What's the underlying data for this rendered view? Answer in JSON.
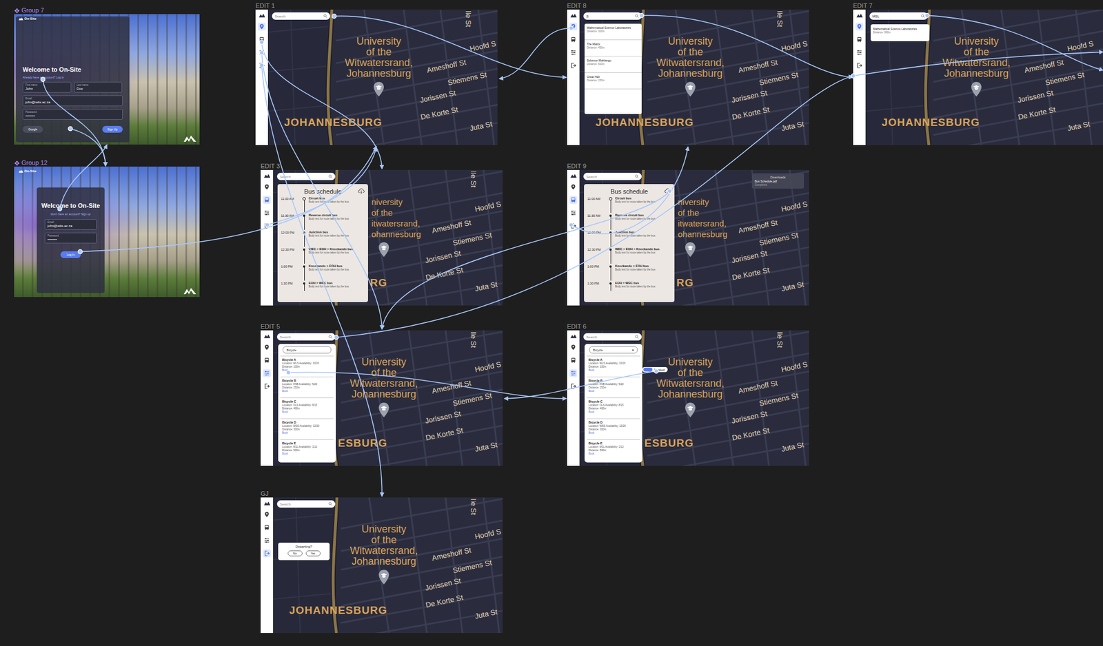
{
  "canvas": {
    "login_frames": [
      {
        "label": "Group 7",
        "kind": "signup",
        "brand": "On-Site",
        "title": "Welcome to On-Site",
        "subtitle": "Already have an account? Log in",
        "fields": [
          {
            "label": "First name",
            "value": "John",
            "kind": "half"
          },
          {
            "label": "Last name",
            "value": "Doe",
            "kind": "half"
          },
          {
            "label": "Email",
            "value": "john@wits.ac.za",
            "kind": "full"
          },
          {
            "label": "Password",
            "value": "••••••••",
            "kind": "full"
          }
        ],
        "buttons": [
          {
            "label": "Google",
            "kind": "secondary"
          },
          {
            "label": "Sign Up",
            "kind": "primary"
          }
        ]
      },
      {
        "label": "Group 12",
        "kind": "login",
        "brand": "On-Site",
        "title": "Welcome to On-Site",
        "subtitle": "Don't have an account? Sign up",
        "fields": [
          {
            "label": "Email",
            "value": "john@wits.ac.za",
            "kind": "full"
          },
          {
            "label": "Password",
            "value": "••••••••",
            "kind": "full"
          }
        ],
        "buttons": [
          {
            "label": "Log In",
            "kind": "primary"
          }
        ]
      }
    ],
    "screens": [
      {
        "label": "EDIT 1",
        "search": {
          "text": "Search",
          "typed": false
        },
        "nav": [
          {
            "selected": true
          },
          {
            "selected": false
          },
          {
            "selected": false
          },
          {
            "selected": false
          }
        ],
        "panel": null,
        "popup": null,
        "map": {
          "campus": [
            "University",
            "of the",
            "Witwatersrand,",
            "Johannesburg"
          ],
          "streets": [
            {
              "text": "lle St",
              "kind": "vertical"
            },
            {
              "text": "Hoofd S",
              "kind": "horizontal"
            },
            {
              "text": "Ameshoff St",
              "kind": "horizontal"
            },
            {
              "text": "Stiemens St",
              "kind": "horizontal"
            },
            {
              "text": "Jorissen St",
              "kind": "horizontal"
            },
            {
              "text": "De Korte St",
              "kind": "horizontal"
            },
            {
              "text": "Juta St",
              "kind": "horizontal"
            }
          ],
          "city": "JOHANNESBURG"
        }
      },
      {
        "label": "EDIT 8",
        "search": {
          "text": "S",
          "typed": true
        },
        "nav": [
          {
            "selected": true
          },
          {
            "selected": false
          },
          {
            "selected": false
          },
          {
            "selected": false
          }
        ],
        "panel": {
          "kind": "places",
          "items": [
            {
              "name": "Mathematical Science Laboratories",
              "detail": "Distance: 300m"
            },
            {
              "name": "The Matrix",
              "detail": "Distance: 450m"
            },
            {
              "name": "Solomon Mahlangu",
              "detail": "Distance: 600m"
            },
            {
              "name": "Great Hall",
              "detail": "Distance: 150m"
            }
          ]
        },
        "popup": null,
        "map": {
          "campus": [
            "University",
            "of the",
            "Witwatersrand,",
            "Johannesburg"
          ],
          "streets": [
            {
              "text": "lle St",
              "kind": "vertical"
            },
            {
              "text": "Hoofd S",
              "kind": "horizontal"
            },
            {
              "text": "Ameshoff St",
              "kind": "horizontal"
            },
            {
              "text": "Stiemens St",
              "kind": "horizontal"
            },
            {
              "text": "Jorissen St",
              "kind": "horizontal"
            },
            {
              "text": "De Korte St",
              "kind": "horizontal"
            },
            {
              "text": "Juta St",
              "kind": "horizontal"
            }
          ],
          "city": "JOHANNESBURG"
        }
      },
      {
        "label": "EDIT 7",
        "search": {
          "text": "MSL",
          "typed": true
        },
        "nav": [
          {
            "selected": true
          },
          {
            "selected": false
          },
          {
            "selected": false
          },
          {
            "selected": false
          }
        ],
        "panel": {
          "kind": "result",
          "items": [
            {
              "name": "Mathematical Science Laboratories",
              "detail": "Distance: 300m"
            }
          ]
        },
        "popup": null,
        "map": {
          "campus": [
            "University",
            "of the",
            "Witwatersrand,",
            "Johannesburg"
          ],
          "streets": [
            {
              "text": "Hoofd S",
              "kind": "horizontal"
            },
            {
              "text": "Ameshoff St",
              "kind": "horizontal"
            },
            {
              "text": "Stiemens St",
              "kind": "horizontal"
            },
            {
              "text": "Jorissen St",
              "kind": "horizontal"
            },
            {
              "text": "De Korte St",
              "kind": "horizontal"
            },
            {
              "text": "Juta St",
              "kind": "horizontal"
            }
          ],
          "city": "JOHANNESBURG"
        }
      },
      {
        "label": "EDIT 3",
        "search": {
          "text": "Search",
          "typed": false
        },
        "nav": [
          {
            "selected": false
          },
          {
            "selected": true
          },
          {
            "selected": false
          },
          {
            "selected": false
          }
        ],
        "panel": {
          "kind": "bus",
          "title": "Bus schedule",
          "rows": [
            {
              "time": "11:00 AM",
              "name": "Circuit bus",
              "note": "Body text for route taken by the bus",
              "current": true
            },
            {
              "time": "11:30 AM",
              "name": "Reverse circuit bus",
              "note": "Body text for route taken by the bus",
              "current": false
            },
            {
              "time": "12:00 PM",
              "name": "Junction bus",
              "note": "Body text for route taken by the bus",
              "current": false
            },
            {
              "time": "12:30 PM",
              "name": "WEC > EOH > Knockando bus",
              "note": "Body text for route taken by the bus",
              "current": false
            },
            {
              "time": "1:00 PM",
              "name": "Knockando > EOH bus",
              "note": "Body text for route taken by the bus",
              "current": false
            },
            {
              "time": "1:30 PM",
              "name": "EOH > WEC bus",
              "note": "Body text for route taken by the bus",
              "current": false
            }
          ]
        },
        "popup": null,
        "map": {
          "campus": [
            "niversity",
            "of the",
            "itwatersrand,",
            "ohannesburg"
          ],
          "streets": [
            {
              "text": "lle St",
              "kind": "vertical"
            },
            {
              "text": "Hoofd S",
              "kind": "horizontal"
            },
            {
              "text": "Ameshoff St",
              "kind": "horizontal"
            },
            {
              "text": "Stiemens St",
              "kind": "horizontal"
            },
            {
              "text": "Jorissen St",
              "kind": "horizontal"
            },
            {
              "text": "De Korte St",
              "kind": "horizontal"
            },
            {
              "text": "Juta St",
              "kind": "horizontal"
            }
          ],
          "city": "RG"
        }
      },
      {
        "label": "EDIT 9",
        "search": {
          "text": "Search",
          "typed": false
        },
        "nav": [
          {
            "selected": false
          },
          {
            "selected": true
          },
          {
            "selected": false
          },
          {
            "selected": false
          }
        ],
        "panel": {
          "kind": "bus",
          "title": "Bus schedule",
          "rows": [
            {
              "time": "11:00 AM",
              "name": "Circuit bus",
              "note": "Body text for route taken by the bus",
              "current": true
            },
            {
              "time": "11:30 AM",
              "name": "Reverse circuit bus",
              "note": "Body text for route taken by the bus",
              "current": false
            },
            {
              "time": "12:00 PM",
              "name": "Junction bus",
              "note": "Body text for route taken by the bus",
              "current": false
            },
            {
              "time": "12:30 PM",
              "name": "WEC > EOH > Knockando bus",
              "note": "Body text for route taken by the bus",
              "current": false
            },
            {
              "time": "1:00 PM",
              "name": "Knockando > EOH bus",
              "note": "Body text for route taken by the bus",
              "current": false
            },
            {
              "time": "1:30 PM",
              "name": "EOH > WEC bus",
              "note": "Body text for route taken by the bus",
              "current": false
            }
          ]
        },
        "popup": {
          "kind": "downloads",
          "title": "Downloads",
          "file": "Bus Schedule.pdf",
          "status": "Completed"
        },
        "map": {
          "campus": [
            "niversity",
            "of the",
            "itwatersrand,",
            "ohannesburg"
          ],
          "streets": [
            {
              "text": "Hoofd S",
              "kind": "horizontal"
            },
            {
              "text": "Ameshoff St",
              "kind": "horizontal"
            },
            {
              "text": "Stiemens St",
              "kind": "horizontal"
            },
            {
              "text": "Jorissen St",
              "kind": "horizontal"
            },
            {
              "text": "De Korte St",
              "kind": "horizontal"
            },
            {
              "text": "Juta St",
              "kind": "horizontal"
            }
          ],
          "city": "RG"
        }
      },
      {
        "label": "EDIT 5",
        "search": {
          "text": "Search",
          "typed": false
        },
        "nav": [
          {
            "selected": false
          },
          {
            "selected": false
          },
          {
            "selected": true
          },
          {
            "selected": false
          }
        ],
        "panel": {
          "kind": "bikes",
          "filter": {
            "label": "Bicycle",
            "caret": ""
          },
          "items": [
            {
              "name": "Bicycle A",
              "location": "Location: WLS Availability: 10/20",
              "distance": "Distance: 100m",
              "action": "Book"
            },
            {
              "name": "Bicycle B",
              "location": "Location: FNB Availability: 5/20",
              "distance": "Distance: 250m",
              "action": "Book"
            },
            {
              "name": "Bicycle C",
              "location": "Location: OLS Availability: 8/15",
              "distance": "Distance: 400m",
              "action": "Book"
            },
            {
              "name": "Bicycle D",
              "location": "Location: WSS Availability: 12/20",
              "distance": "Distance: 300m",
              "action": "Book"
            },
            {
              "name": "Bicycle E",
              "location": "Location: MSL Availability: 3/10",
              "distance": "Distance: 500m",
              "action": "Book"
            }
          ]
        },
        "popup": null,
        "map": {
          "campus": [
            "University",
            "of the",
            "Witwatersrand,",
            "Johannesburg"
          ],
          "streets": [
            {
              "text": "lle St",
              "kind": "vertical"
            },
            {
              "text": "Hoofd S",
              "kind": "horizontal"
            },
            {
              "text": "Ameshoff St",
              "kind": "horizontal"
            },
            {
              "text": "Stiemens St",
              "kind": "horizontal"
            },
            {
              "text": "Jorissen St",
              "kind": "horizontal"
            },
            {
              "text": "De Korte St",
              "kind": "horizontal"
            },
            {
              "text": "Juta St",
              "kind": "horizontal"
            }
          ],
          "city": "ESBURG"
        }
      },
      {
        "label": "EDIT 6",
        "search": {
          "text": "Search",
          "typed": false
        },
        "nav": [
          {
            "selected": false
          },
          {
            "selected": false
          },
          {
            "selected": true
          },
          {
            "selected": false
          }
        ],
        "panel": {
          "kind": "bikes",
          "filter": {
            "label": "Bicycle",
            "caret": "▾"
          },
          "items": [
            {
              "name": "Bicycle A",
              "location": "Location: WLS Availability: 10/20",
              "distance": "Distance: 100m",
              "action": "Book"
            },
            {
              "name": "Bicycle B",
              "location": "Location: FNB Availability: 5/20",
              "distance": "Distance: 250m",
              "action": "Book"
            },
            {
              "name": "Bicycle C",
              "location": "Location: OLS Availability: 8/15",
              "distance": "Distance: 400m",
              "action": "Book"
            },
            {
              "name": "Bicycle D",
              "location": "Location: WSS Availability: 12/20",
              "distance": "Distance: 300m",
              "action": "Book"
            },
            {
              "name": "Bicycle E",
              "location": "Location: MSL Availability: 3/10",
              "distance": "Distance: 500m",
              "action": "Book"
            }
          ]
        },
        "popup": {
          "kind": "toast",
          "text": "Booked"
        },
        "map": {
          "campus": [
            "University",
            "of the",
            "Witwatersrand,",
            "Johannesburg"
          ],
          "streets": [
            {
              "text": "lle St",
              "kind": "vertical"
            },
            {
              "text": "Hoofd S",
              "kind": "horizontal"
            },
            {
              "text": "Ameshoff St",
              "kind": "horizontal"
            },
            {
              "text": "Stiemens St",
              "kind": "horizontal"
            },
            {
              "text": "Jorissen St",
              "kind": "horizontal"
            },
            {
              "text": "De Korte St",
              "kind": "horizontal"
            },
            {
              "text": "Juta St",
              "kind": "horizontal"
            }
          ],
          "city": "ESBURG"
        }
      },
      {
        "label": "GJ",
        "search": {
          "text": "Search",
          "typed": false
        },
        "nav": [
          {
            "selected": false
          },
          {
            "selected": false
          },
          {
            "selected": false
          },
          {
            "selected": true
          }
        ],
        "panel": {
          "kind": "dialog",
          "title": "Departing?",
          "buttons": [
            {
              "label": "No"
            },
            {
              "label": "Yes"
            }
          ]
        },
        "popup": null,
        "map": {
          "campus": [
            "University",
            "of the",
            "Witwatersrand,",
            "Johannesburg"
          ],
          "streets": [
            {
              "text": "lle St",
              "kind": "vertical"
            },
            {
              "text": "Hoofd S",
              "kind": "horizontal"
            },
            {
              "text": "Ameshoff St",
              "kind": "horizontal"
            },
            {
              "text": "Stiemens St",
              "kind": "horizontal"
            },
            {
              "text": "Jorissen St",
              "kind": "horizontal"
            },
            {
              "text": "De Korte St",
              "kind": "horizontal"
            },
            {
              "text": "Juta St",
              "kind": "horizontal"
            }
          ],
          "city": "JOHANNESBURG"
        }
      }
    ]
  }
}
